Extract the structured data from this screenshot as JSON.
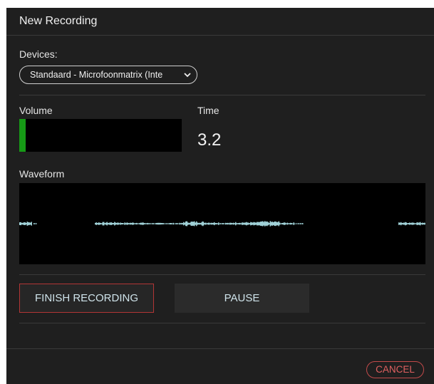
{
  "dialog": {
    "title": "New Recording",
    "devices_label": "Devices:",
    "device_selected": "Standaard - Microfoonmatrix (Inte",
    "volume_label": "Volume",
    "volume_level": 0.04,
    "time_label": "Time",
    "time_value": "3.2",
    "waveform_label": "Waveform",
    "finish_button": "FINISH RECORDING",
    "pause_button": "PAUSE",
    "cancel_button": "CANCEL"
  },
  "colors": {
    "background": "#1f1f1f",
    "volume_fill": "#169a16",
    "waveform": "#9fd0d6",
    "danger": "#c24a4a"
  },
  "icons": {
    "select_arrow": "chevron-down-icon"
  }
}
